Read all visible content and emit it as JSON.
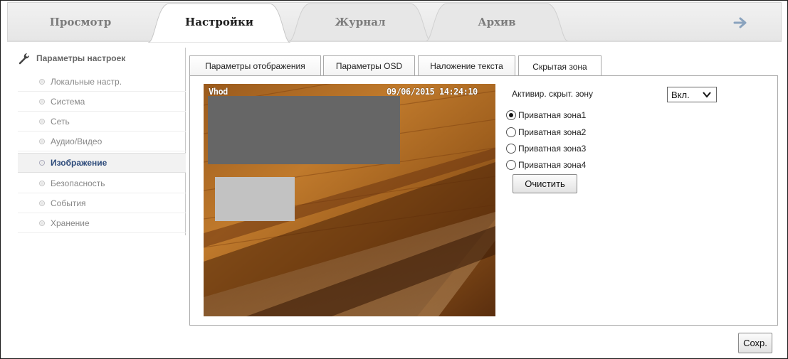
{
  "top_tabs": [
    {
      "label": "Просмотр",
      "active": false
    },
    {
      "label": "Настройки",
      "active": true
    },
    {
      "label": "Журнал",
      "active": false
    },
    {
      "label": "Архив",
      "active": false
    }
  ],
  "logout_icon": "arrow-right-icon",
  "sidebar": {
    "title": "Параметры настроек",
    "title_icon": "wrench-icon",
    "items": [
      {
        "label": "Локальные настр.",
        "active": false
      },
      {
        "label": "Система",
        "active": false
      },
      {
        "label": "Сеть",
        "active": false
      },
      {
        "label": "Аудио/Видео",
        "active": false
      },
      {
        "label": "Изображение",
        "active": true
      },
      {
        "label": "Безопасность",
        "active": false
      },
      {
        "label": "События",
        "active": false
      },
      {
        "label": "Хранение",
        "active": false
      }
    ]
  },
  "sub_tabs": [
    {
      "label": "Параметры отображения",
      "active": false
    },
    {
      "label": "Параметры OSD",
      "active": false
    },
    {
      "label": "Наложение текста",
      "active": false
    },
    {
      "label": "Скрытая зона",
      "active": true
    }
  ],
  "video": {
    "channel_name": "Vhod",
    "timestamp": "09/06/2015 14:24:10"
  },
  "privacy": {
    "activate_label": "Активир. скрыт. зону",
    "activate_value": "Вкл.",
    "zones": [
      {
        "label": "Приватная зона1",
        "checked": true
      },
      {
        "label": "Приватная зона2",
        "checked": false
      },
      {
        "label": "Приватная зона3",
        "checked": false
      },
      {
        "label": "Приватная зона4",
        "checked": false
      }
    ],
    "clear_label": "Очистить"
  },
  "save_label": "Сохр.",
  "colors": {
    "active_sidebar_text": "#2c4a7a",
    "mask_primary": "#666666",
    "mask_secondary": "#c2c2c2"
  }
}
